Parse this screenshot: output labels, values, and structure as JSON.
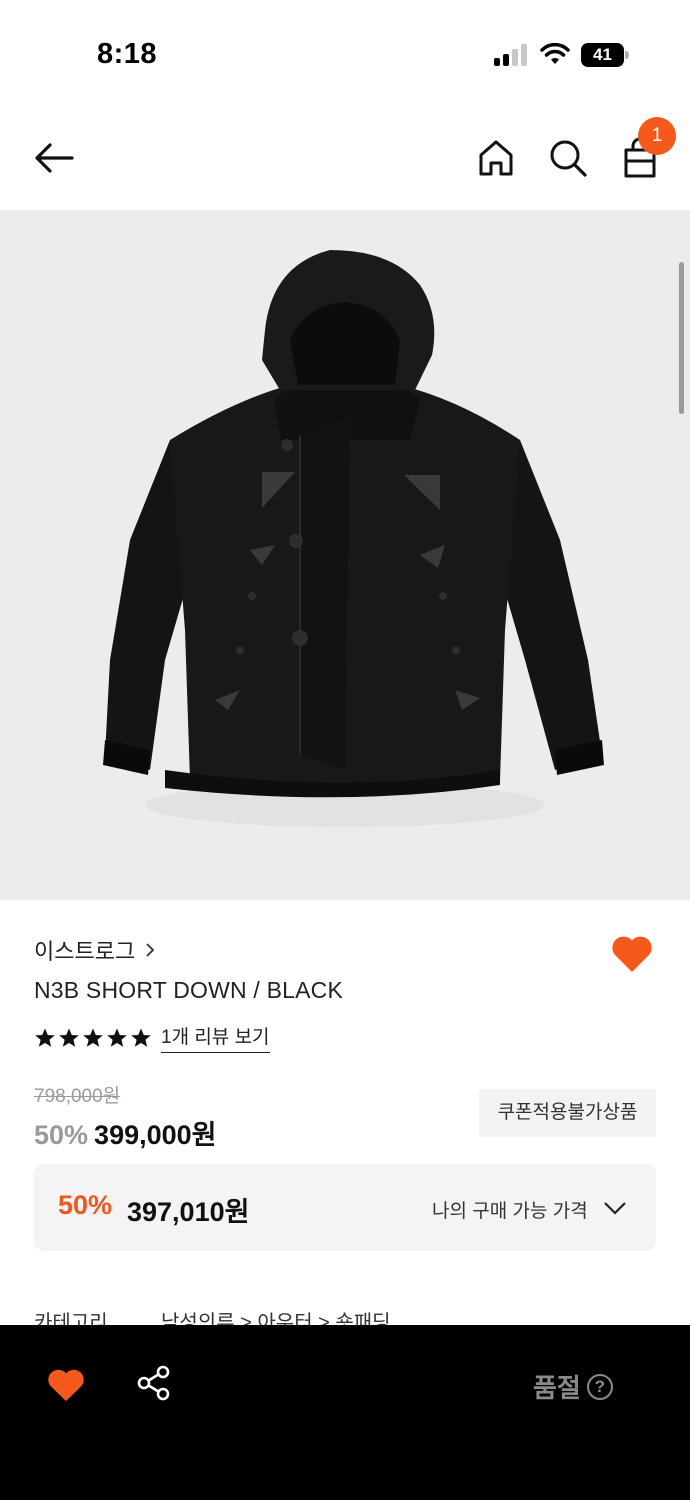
{
  "status_bar": {
    "time": "8:18",
    "battery": "41"
  },
  "header": {
    "cart_count": "1",
    "icons": [
      "back-arrow-icon",
      "home-icon",
      "search-icon",
      "shopping-bag-icon"
    ]
  },
  "product": {
    "image_description_icon": "black-hooded-down-jacket-image",
    "brand": "이스트로그",
    "name": "N3B SHORT DOWN / BLACK",
    "rating_stars": 5,
    "review_link": "1개 리뷰 보기",
    "original_price": "798,000원",
    "sale_rate": "50%",
    "sale_price": "399,000원",
    "coupon_notice": "쿠폰적용불가상품",
    "my_price": {
      "rate": "50%",
      "amount": "397,010원",
      "label": "나의 구매 가능 가격"
    },
    "category": {
      "label": "카테고리",
      "path": "남성의류 > 아우터 > 숏패딩"
    }
  },
  "bottom_bar": {
    "status_label": "품절",
    "help_glyph": "?"
  },
  "colors": {
    "accent": "#f55a1c",
    "bottom_bar": "#000000",
    "muted": "#9a9a9a"
  }
}
